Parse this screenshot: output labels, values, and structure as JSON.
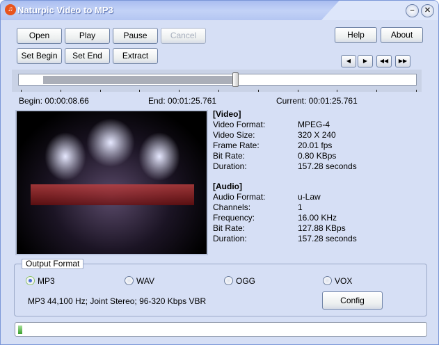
{
  "window": {
    "title": "Naturpic Video to MP3",
    "icon": "music-note-icon"
  },
  "toolbar": {
    "open": "Open",
    "play": "Play",
    "pause": "Pause",
    "cancel": "Cancel",
    "set_begin": "Set Begin",
    "set_end": "Set End",
    "extract": "Extract",
    "help": "Help",
    "about": "About"
  },
  "nav": {
    "prev": "◀",
    "next": "▶",
    "rewind": "◀◀",
    "forward": "▶▶"
  },
  "slider": {
    "selection_start_fraction": 0.061,
    "selection_end_fraction": 0.544,
    "current_fraction": 0.544
  },
  "times": {
    "begin": "Begin: 00:00:08.66",
    "end": "End: 00:01:25.761",
    "current": "Current: 00:01:25.761"
  },
  "video_info": {
    "header": "[Video]",
    "rows": [
      [
        "Video Format:",
        "MPEG-4"
      ],
      [
        "Video Size:",
        "320 X 240"
      ],
      [
        "Frame Rate:",
        "20.01 fps"
      ],
      [
        "Bit Rate:",
        "0.80 KBps"
      ],
      [
        "Duration:",
        "157.28 seconds"
      ]
    ]
  },
  "audio_info": {
    "header": "[Audio]",
    "rows": [
      [
        "Audio Format:",
        "u-Law"
      ],
      [
        "Channels:",
        "1"
      ],
      [
        "Frequency:",
        "16.00 KHz"
      ],
      [
        "Bit Rate:",
        "127.88 KBps"
      ],
      [
        "Duration:",
        "157.28 seconds"
      ]
    ]
  },
  "output": {
    "legend": "Output Format",
    "options": [
      "MP3",
      "WAV",
      "OGG",
      "VOX"
    ],
    "selected": "MP3",
    "summary": "MP3 44,100 Hz; Joint Stereo;  96-320 Kbps VBR",
    "config": "Config"
  },
  "progress": {
    "fraction": 0.01
  }
}
